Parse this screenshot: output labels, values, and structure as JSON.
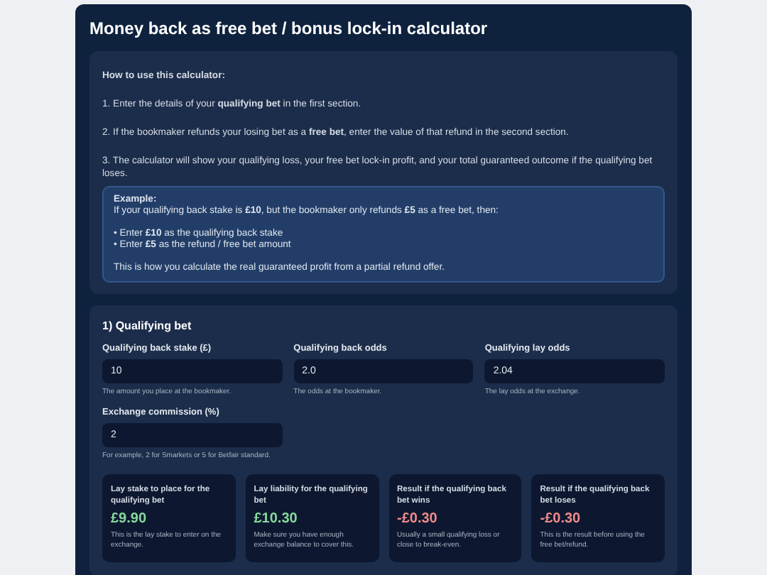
{
  "title": "Money back as free bet / bonus lock-in calculator",
  "instructions": {
    "heading": "How to use this calculator:",
    "steps": [
      "1. Enter the details of your **qualifying bet** in the first section.",
      "2. If the bookmaker refunds your losing bet as a **free bet**, enter the value of that refund in the second section.",
      "3. The calculator will show your qualifying loss, your free bet lock-in profit, and your total guaranteed outcome if the qualifying bet loses."
    ],
    "example": {
      "heading": "Example:",
      "intro": "If your qualifying back stake is **£10**, but the bookmaker only refunds **£5** as a free bet, then:",
      "bullets": [
        "• Enter **£10** as the qualifying back stake",
        "• Enter **£5** as the refund / free bet amount"
      ],
      "outro": "This is how you calculate the real guaranteed profit from a partial refund offer."
    }
  },
  "qualifying_bet": {
    "heading": "1) Qualifying bet",
    "fields": [
      {
        "label": "Qualifying back stake (£)",
        "value": "10",
        "hint": "The amount you place at the bookmaker."
      },
      {
        "label": "Qualifying back odds",
        "value": "2.0",
        "hint": "The odds at the bookmaker."
      },
      {
        "label": "Qualifying lay odds",
        "value": "2.04",
        "hint": "The lay odds at the exchange."
      },
      {
        "label": "Exchange commission (%)",
        "value": "2",
        "hint": "For example, 2 for Smarkets or 5 for Betfair standard."
      }
    ],
    "results": [
      {
        "label": "Lay stake to place for the qualifying bet",
        "value": "£9.90",
        "color": "#86d99b",
        "note": "This is the lay stake to enter on the exchange."
      },
      {
        "label": "Lay liability for the qualifying bet",
        "value": "£10.30",
        "color": "#86d99b",
        "note": "Make sure you have enough exchange balance to cover this."
      },
      {
        "label": "Result if the qualifying back bet wins",
        "value": "-£0.30",
        "color": "#f08a8a",
        "note": "Usually a small qualifying loss or close to break-even."
      },
      {
        "label": "Result if the qualifying back bet loses",
        "value": "-£0.30",
        "color": "#f08a8a",
        "note": "This is the result before using the free bet/refund."
      }
    ]
  }
}
